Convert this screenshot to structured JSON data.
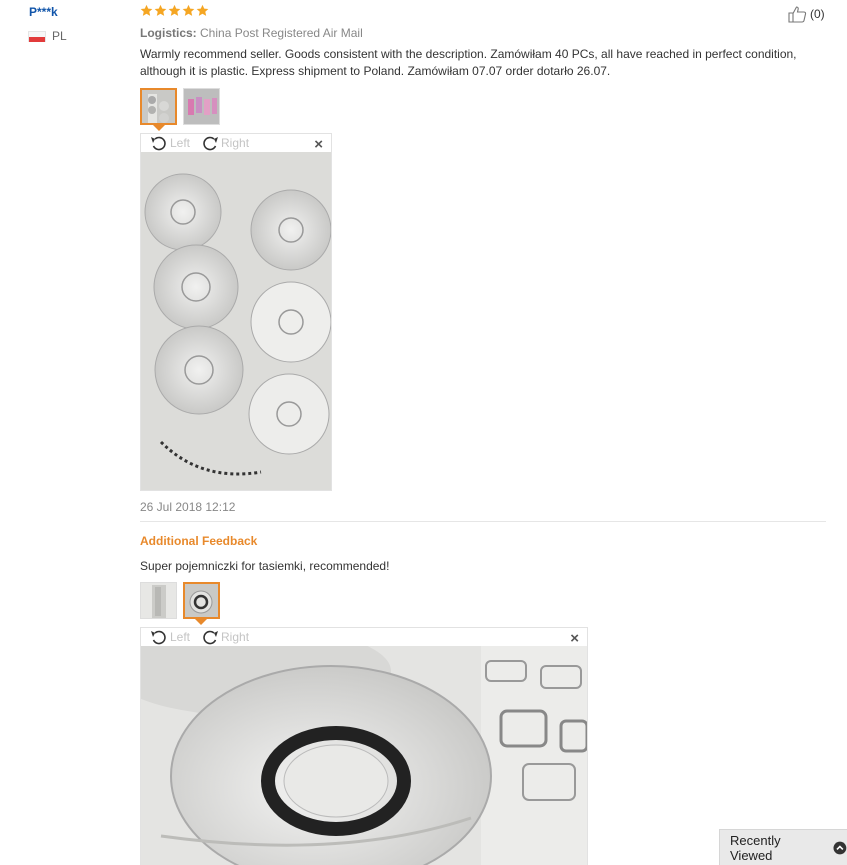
{
  "buyer": {
    "name": "P***k",
    "country": "PL"
  },
  "rating": {
    "stars": 5
  },
  "helpful": {
    "count": "(0)"
  },
  "logistics": {
    "label": "Logistics:",
    "value": "China Post Registered Air Mail"
  },
  "review": {
    "text": "Warmly recommend seller. Goods consistent with the description. Zamówiłam 40 PCs, all have reached in perfect condition, although it is plastic. Express shipment to Poland. Zamówiłam 07.07 order dotarło 26.07.",
    "timestamp": "26 Jul 2018 12:12"
  },
  "viewer": {
    "rotate_left": "Left",
    "rotate_right": "Right",
    "close": "×"
  },
  "additional_feedback": {
    "heading": "Additional Feedback",
    "text": "Super pojemniczki for tasiemki, recommended!"
  },
  "recently_viewed": {
    "label": "Recently Viewed"
  },
  "colors": {
    "accent": "#e8892b",
    "name_blue": "#1155aa",
    "star": "#f5a623"
  }
}
